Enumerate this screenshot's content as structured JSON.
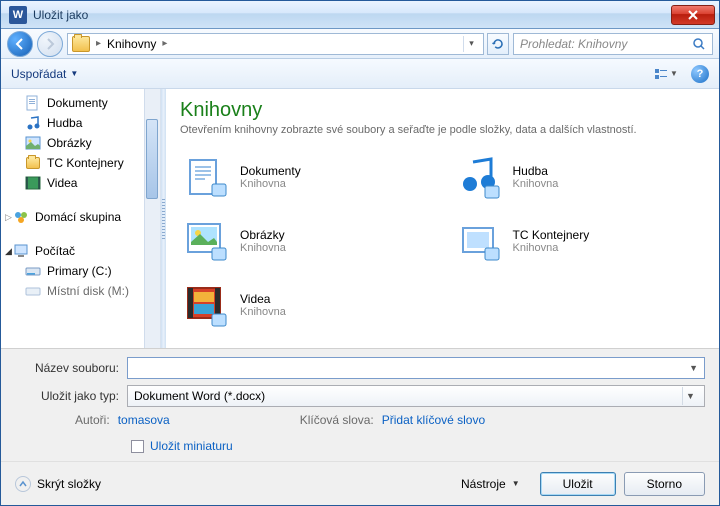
{
  "window": {
    "title": "Uložit jako"
  },
  "nav": {
    "breadcrumb": [
      "Knihovny"
    ],
    "search_placeholder": "Prohledat: Knihovny"
  },
  "toolbar": {
    "organize": "Uspořádat"
  },
  "sidebar": {
    "items": [
      {
        "label": "Dokumenty",
        "icon": "doc"
      },
      {
        "label": "Hudba",
        "icon": "music"
      },
      {
        "label": "Obrázky",
        "icon": "image"
      },
      {
        "label": "TC Kontejnery",
        "icon": "tc"
      },
      {
        "label": "Videa",
        "icon": "video"
      }
    ],
    "homegroup": "Domácí skupina",
    "computer": "Počítač",
    "drives": [
      {
        "label": "Primary (C:)"
      },
      {
        "label": "Místní disk (M:)"
      }
    ]
  },
  "main": {
    "title": "Knihovny",
    "subtitle": "Otevřením knihovny zobrazte své soubory a seřaďte je podle složky, data a dalších vlastností.",
    "libs": [
      {
        "name": "Dokumenty",
        "kind": "Knihovna",
        "icon": "doc"
      },
      {
        "name": "Hudba",
        "kind": "Knihovna",
        "icon": "music"
      },
      {
        "name": "Obrázky",
        "kind": "Knihovna",
        "icon": "image"
      },
      {
        "name": "TC Kontejnery",
        "kind": "Knihovna",
        "icon": "tc"
      },
      {
        "name": "Videa",
        "kind": "Knihovna",
        "icon": "video"
      }
    ]
  },
  "form": {
    "filename_label": "Název souboru:",
    "filename_value": "",
    "filetype_label": "Uložit jako typ:",
    "filetype_value": "Dokument Word (*.docx)",
    "authors_label": "Autoři:",
    "authors_value": "tomasova",
    "tags_label": "Klíčová slova:",
    "tags_value": "Přidat klíčové slovo",
    "thumb_label": "Uložit miniaturu"
  },
  "footer": {
    "hide_folders": "Skrýt složky",
    "tools": "Nástroje",
    "save": "Uložit",
    "cancel": "Storno"
  }
}
